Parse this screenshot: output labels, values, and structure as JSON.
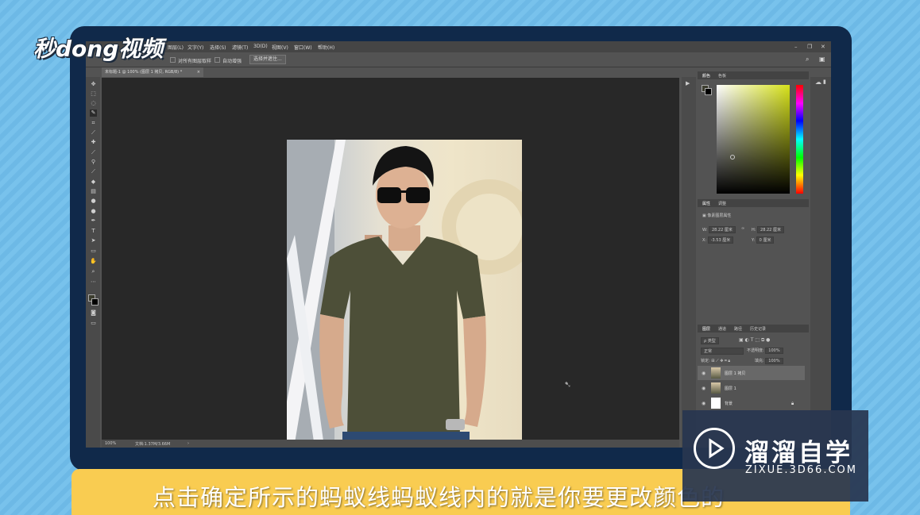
{
  "branding": {
    "logo_text": "秒dong视频"
  },
  "menu": [
    "图层(L)",
    "文字(Y)",
    "选择(S)",
    "滤镜(T)",
    "3D(D)",
    "视图(V)",
    "窗口(W)",
    "帮助(H)"
  ],
  "options": {
    "sample_all_layers": "对所有图层取样",
    "auto_enhance": "自动增强",
    "refine_button": "选择并遮住..."
  },
  "document": {
    "tab_title": "未标题-1 @ 100% (图层 1 拷贝, RGB/8) *",
    "close": "×"
  },
  "status": {
    "zoom": "100%",
    "doc_size": "文档:1.37M/3.66M"
  },
  "color_panel": {
    "tabs": [
      "颜色",
      "色板"
    ]
  },
  "properties_panel": {
    "tabs": [
      "属性",
      "调整"
    ],
    "title": "像素图层属性",
    "w_label": "W:",
    "w_value": "28.22 厘米",
    "h_label": "H:",
    "h_value": "28.22 厘米",
    "link_icon": "∞",
    "x_label": "X:",
    "x_value": "-3.53 厘米",
    "y_label": "Y:",
    "y_value": "0 厘米"
  },
  "layers_panel": {
    "tabs": [
      "图层",
      "通道",
      "路径",
      "历史记录"
    ],
    "filter_label": "ρ 类型",
    "blend_mode": "正常",
    "opacity_label": "不透明度:",
    "opacity_value": "100%",
    "lock_label": "锁定:",
    "fill_label": "填充:",
    "fill_value": "100%",
    "layers": [
      {
        "name": "图层 1 拷贝",
        "selected": true
      },
      {
        "name": "图层 1",
        "selected": false
      },
      {
        "name": "背景",
        "selected": false
      }
    ]
  },
  "subtitle": "点击确定所示的蚂蚁线蚂蚁线内的就是你要更改颜色的",
  "watermark": {
    "title": "溜溜自学",
    "url": "ZIXUE.3D66.COM"
  },
  "colors": {
    "frame": "#10294a",
    "subtitle_bar": "#f9cc51",
    "shirt": "#4d4f38"
  }
}
